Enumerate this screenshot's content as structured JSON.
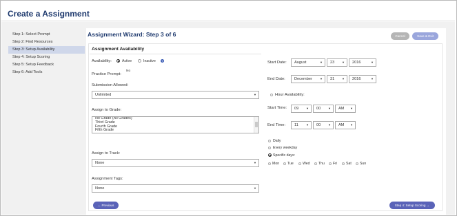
{
  "page": {
    "title": "Create a Assignment"
  },
  "sidebar": {
    "items": [
      {
        "label": "Step 1: Select Prompt",
        "active": false
      },
      {
        "label": "Step 2: Find Resources",
        "active": false
      },
      {
        "label": "Step 3: Setup Availability",
        "active": true
      },
      {
        "label": "Step 4: Setup Scoring",
        "active": false
      },
      {
        "label": "Step 5: Setup Feedback",
        "active": false
      },
      {
        "label": "Step 6: Add Tools",
        "active": false
      }
    ]
  },
  "wizard": {
    "title": "Assignment Wizard: Step 3 of 6",
    "cancel_label": "Cancel",
    "save_exit_label": "Save & Exit",
    "previous_label": "← Previous",
    "next_label": "Step 4: Setup Scoring →"
  },
  "availability": {
    "section_title": "Assignment Availability",
    "availability_label": "Availability:",
    "active_label": "Active",
    "inactive_label": "Inactive",
    "selected": "Active",
    "practice_prompt_label": "Practice Prompt:",
    "practice_prompt_value": "No",
    "submission_label": "Submission Allowed:",
    "submission_value": "Unlimited",
    "grade_label": "Assign to Grade:",
    "grade_options": [
      "No Grade (All Grades)",
      "Third Grade",
      "Fourth Grade",
      "Fifth Grade"
    ],
    "track_label": "Assign to Track:",
    "track_value": "None",
    "tags_label": "Assignment Tags:",
    "tags_value": "None"
  },
  "schedule": {
    "start_date_label": "Start Date:",
    "start_month": "August",
    "start_day": "23",
    "start_year": "2016",
    "end_date_label": "End Date:",
    "end_month": "December",
    "end_day": "31",
    "end_year": "2016",
    "hour_availability_label": "Hour Availability:",
    "start_time_label": "Start Time:",
    "start_hour": "09",
    "start_minute": "00",
    "start_ampm": "AM",
    "end_time_label": "End Time:",
    "end_hour": "11",
    "end_minute": "00",
    "end_ampm": "AM",
    "daily_label": "Daily",
    "every_weekday_label": "Every weekday",
    "specific_days_label": "Specific days:",
    "recurrence_selected": "Specific days",
    "days": [
      "Mon",
      "Tue",
      "Wed",
      "Thu",
      "Fri",
      "Sat",
      "Sun"
    ]
  },
  "colors": {
    "title_blue": "#1f3a6e",
    "primary_button": "#5a63b8",
    "save_button": "#9aa6dc",
    "cancel_button": "#b5b5b5",
    "active_step_bg": "#cfd7ea"
  }
}
